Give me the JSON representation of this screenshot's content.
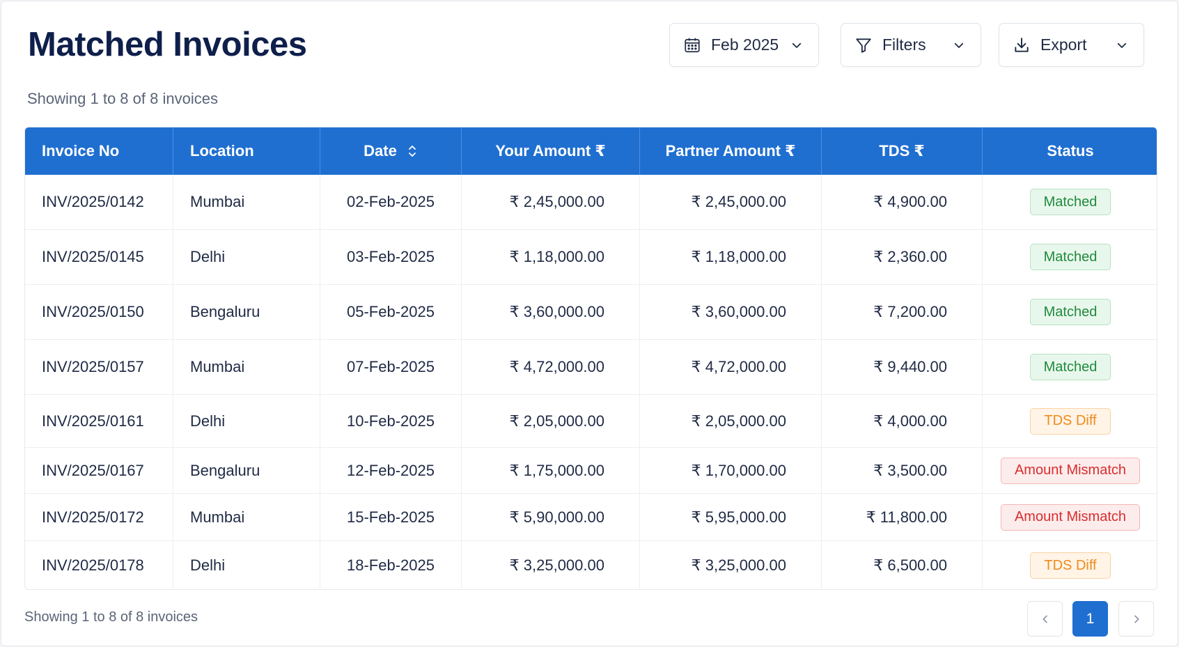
{
  "page": {
    "title": "Matched Invoices",
    "summary_top": "Showing 1 to 8 of 8 invoices",
    "summary_bottom": "Showing 1 to 8 of 8 invoices"
  },
  "toolbar": {
    "date": {
      "label": "Feb 2025",
      "icon": "calendar-icon"
    },
    "filters": {
      "label": "Filters",
      "icon": "filter-icon"
    },
    "export": {
      "label": "Export",
      "icon": "download-icon"
    }
  },
  "table": {
    "columns": [
      "Invoice No",
      "Location",
      "Date",
      "Your Amount ₹",
      "Partner Amount ₹",
      "TDS ₹",
      "Status"
    ],
    "rows": [
      {
        "invoice": "INV/2025/0142",
        "location": "Mumbai",
        "date": "02-Feb-2025",
        "your_amount": "₹ 2,45,000.00",
        "partner_amount": "₹ 2,45,000.00",
        "tds": "₹ 4,900.00",
        "status": "Matched"
      },
      {
        "invoice": "INV/2025/0145",
        "location": "Delhi",
        "date": "03-Feb-2025",
        "your_amount": "₹ 1,18,000.00",
        "partner_amount": "₹ 1,18,000.00",
        "tds": "₹ 2,360.00",
        "status": "Matched"
      },
      {
        "invoice": "INV/2025/0150",
        "location": "Bengaluru",
        "date": "05-Feb-2025",
        "your_amount": "₹ 3,60,000.00",
        "partner_amount": "₹ 3,60,000.00",
        "tds": "₹ 7,200.00",
        "status": "Matched"
      },
      {
        "invoice": "INV/2025/0157",
        "location": "Mumbai",
        "date": "07-Feb-2025",
        "your_amount": "₹ 4,72,000.00",
        "partner_amount": "₹ 4,72,000.00",
        "tds": "₹ 9,440.00",
        "status": "Matched"
      },
      {
        "invoice": "INV/2025/0161",
        "location": "Delhi",
        "date": "10-Feb-2025",
        "your_amount": "₹ 2,05,000.00",
        "partner_amount": "₹ 2,05,000.00",
        "tds": "₹ 4,000.00",
        "status": "TDS Diff"
      },
      {
        "invoice": "INV/2025/0167",
        "location": "Bengaluru",
        "date": "12-Feb-2025",
        "your_amount": "₹ 1,75,000.00",
        "partner_amount": "₹ 1,70,000.00",
        "tds": "₹ 3,500.00",
        "status": "Amount Mismatch"
      },
      {
        "invoice": "INV/2025/0172",
        "location": "Mumbai",
        "date": "15-Feb-2025",
        "your_amount": "₹ 5,90,000.00",
        "partner_amount": "₹ 5,95,000.00",
        "tds": "₹ 11,800.00",
        "status": "Amount Mismatch"
      },
      {
        "invoice": "INV/2025/0178",
        "location": "Delhi",
        "date": "18-Feb-2025",
        "your_amount": "₹ 3,25,000.00",
        "partner_amount": "₹ 3,25,000.00",
        "tds": "₹ 6,500.00",
        "status": "TDS Diff"
      }
    ]
  },
  "status_colors": {
    "Matched": "#1f8a3b",
    "TDS Diff": "#f08a1c",
    "Amount Mismatch": "#d92d2d"
  },
  "pagination": {
    "current": "1",
    "prev_icon": "chevron-left-icon",
    "next_icon": "chevron-right-icon"
  },
  "colors": {
    "accent": "#1f6fd1",
    "title": "#0f1f4b"
  }
}
